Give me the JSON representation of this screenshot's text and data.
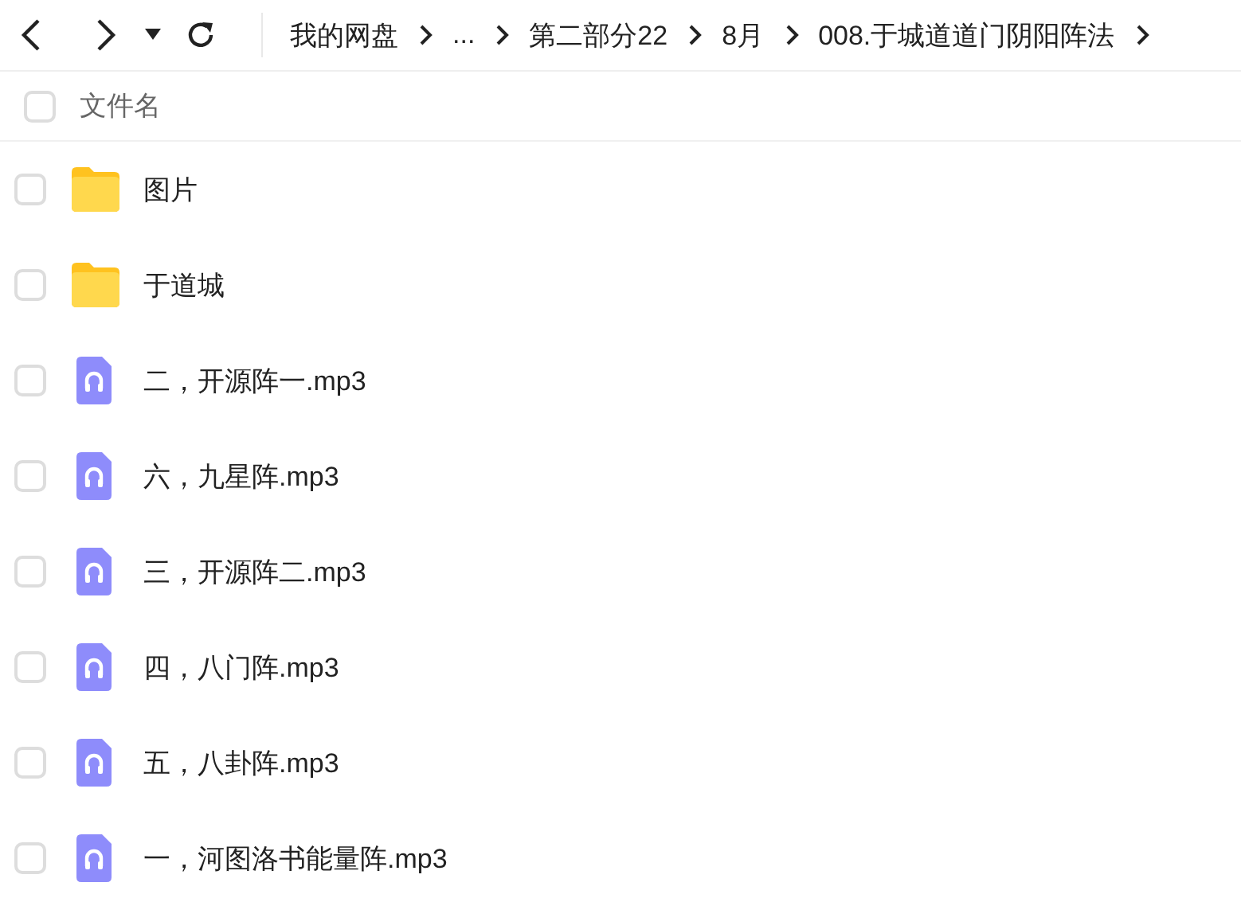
{
  "breadcrumb": [
    {
      "label": "我的网盘"
    },
    {
      "label": "..."
    },
    {
      "label": "第二部分22"
    },
    {
      "label": "8月"
    },
    {
      "label": "008.于城道道门阴阳阵法"
    }
  ],
  "header": {
    "label": "文件名",
    "checked": false
  },
  "files": [
    {
      "name": "图片",
      "kind": "folder",
      "checked": false
    },
    {
      "name": "于道城",
      "kind": "folder",
      "checked": false
    },
    {
      "name": "二，开源阵一.mp3",
      "kind": "audio",
      "checked": false
    },
    {
      "name": "六，九星阵.mp3",
      "kind": "audio",
      "checked": false
    },
    {
      "name": "三，开源阵二.mp3",
      "kind": "audio",
      "checked": false
    },
    {
      "name": "四，八门阵.mp3",
      "kind": "audio",
      "checked": false
    },
    {
      "name": "五，八卦阵.mp3",
      "kind": "audio",
      "checked": false
    },
    {
      "name": "一，河图洛书能量阵.mp3",
      "kind": "audio",
      "checked": false
    }
  ]
}
